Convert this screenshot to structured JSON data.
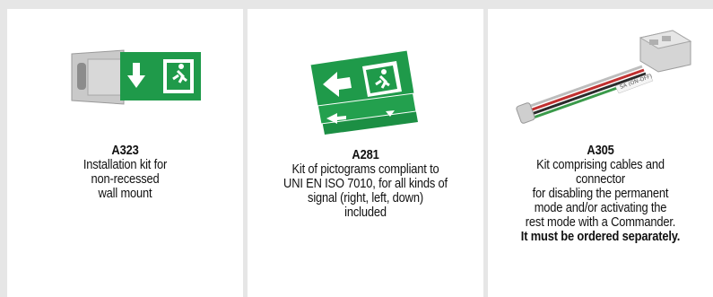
{
  "products": [
    {
      "code": "A323",
      "description_lines": [
        "Installation kit for",
        "non-recessed",
        "wall mount"
      ],
      "image_icon": "wall-mount-kit-sign-icon"
    },
    {
      "code": "A281",
      "description_lines": [
        "Kit of pictograms compliant to",
        "UNI EN ISO 7010, for all kinds of",
        "signal (right, left, down)",
        "included"
      ],
      "image_icon": "pictogram-kit-icon"
    },
    {
      "code": "A305",
      "description_lines": [
        "Kit comprising cables and",
        "connector",
        "for disabling the permanent",
        "mode and/or activating the",
        "rest mode with a Commander."
      ],
      "note": "It must be ordered separately.",
      "connector_label": "SA (ON-OFF)",
      "image_icon": "cable-connector-kit-icon"
    }
  ],
  "colors": {
    "background": "#e6e6e6",
    "card": "#ffffff",
    "sign_green": "#1f9a4a"
  }
}
